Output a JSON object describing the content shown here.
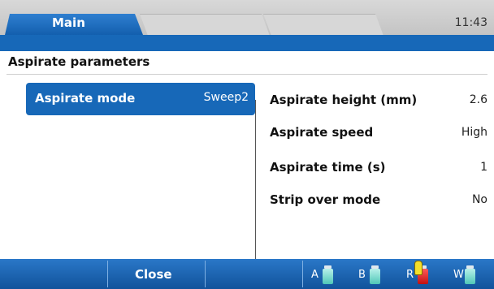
{
  "tabs": [
    {
      "label": "Main",
      "active": true
    },
    {
      "label": "",
      "active": false
    },
    {
      "label": "",
      "active": false
    }
  ],
  "clock": "11:43",
  "section": {
    "title": "Aspirate parameters"
  },
  "aspirate_mode": {
    "label": "Aspirate mode",
    "value": "Sweep2"
  },
  "params": [
    {
      "label": "Aspirate height (mm)",
      "value": "2.6"
    },
    {
      "label": "Aspirate speed",
      "value": "High"
    },
    {
      "label": "Aspirate time (s)",
      "value": "1"
    },
    {
      "label": "Strip over mode",
      "value": "No"
    }
  ],
  "footer": {
    "close_label": "Close",
    "reagents": [
      {
        "letter": "A",
        "color": "#4fc7b7",
        "warning": false
      },
      {
        "letter": "B",
        "color": "#4fc7b7",
        "warning": false
      },
      {
        "letter": "R",
        "color": "#c01010",
        "warning": true
      },
      {
        "letter": "W",
        "color": "#4fc7b7",
        "warning": false
      }
    ]
  },
  "colors": {
    "accent": "#1768b8"
  }
}
